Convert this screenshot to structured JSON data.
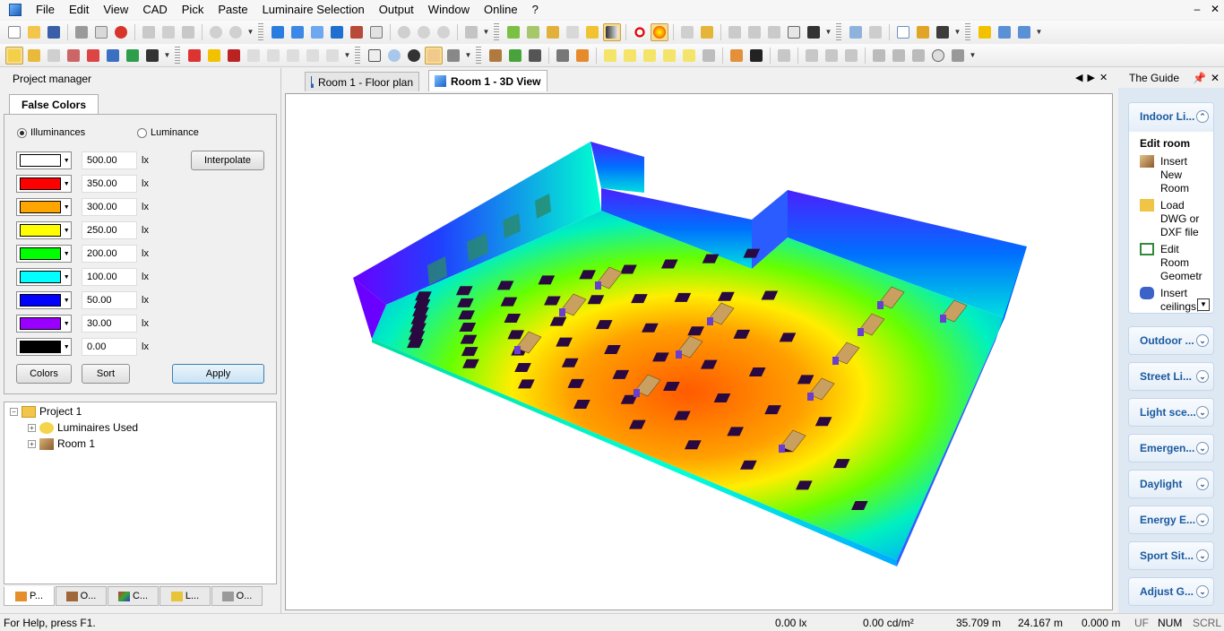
{
  "menu": [
    "File",
    "Edit",
    "View",
    "CAD",
    "Pick",
    "Paste",
    "Luminaire Selection",
    "Output",
    "Window",
    "Online",
    "?"
  ],
  "window_controls": [
    "–",
    "✕"
  ],
  "project_manager": {
    "title": "Project manager",
    "tab": "False Colors",
    "radio_illuminances": "Illuminances",
    "radio_luminance": "Luminance",
    "selected_radio": "Illuminances",
    "levels": [
      {
        "value": "500.00",
        "unit": "lx",
        "color": "#ffffff"
      },
      {
        "value": "350.00",
        "unit": "lx",
        "color": "#ff0000"
      },
      {
        "value": "300.00",
        "unit": "lx",
        "color": "#ffa500"
      },
      {
        "value": "250.00",
        "unit": "lx",
        "color": "#ffff00"
      },
      {
        "value": "200.00",
        "unit": "lx",
        "color": "#00ff00"
      },
      {
        "value": "100.00",
        "unit": "lx",
        "color": "#00ffff"
      },
      {
        "value": "50.00",
        "unit": "lx",
        "color": "#0000ff"
      },
      {
        "value": "30.00",
        "unit": "lx",
        "color": "#9900ff"
      },
      {
        "value": "0.00",
        "unit": "lx",
        "color": "#000000"
      }
    ],
    "interpolate_label": "Interpolate",
    "colors_label": "Colors",
    "sort_label": "Sort",
    "apply_label": "Apply"
  },
  "tree": {
    "project": "Project 1",
    "luminaires": "Luminaires Used",
    "room": "Room 1"
  },
  "bottom_tabs": [
    "P...",
    "O...",
    "C...",
    "L...",
    "O..."
  ],
  "doc_tabs": {
    "floor_plan": "Room 1 - Floor plan",
    "view_3d": "Room 1 - 3D View"
  },
  "guide": {
    "title": "The Guide",
    "expanded_section": "Indoor Li...",
    "subheading": "Edit room",
    "items": [
      {
        "label": "Insert\nNew\nRoom",
        "icon": "room-box-icon"
      },
      {
        "label": "Load\nDWG or\nDXF file",
        "icon": "dxf-folder-icon"
      },
      {
        "label": "Edit\nRoom\nGeometr",
        "icon": "geometry-edit-icon"
      },
      {
        "label": "Insert\nceilings,\nground",
        "icon": "ceiling-cylinder-icon"
      }
    ],
    "sections": [
      "Outdoor ...",
      "Street Li...",
      "Light sce...",
      "Emergen...",
      "Daylight",
      "Energy E...",
      "Sport Sit...",
      "Adjust G..."
    ]
  },
  "status": {
    "help": "For Help, press F1.",
    "illuminance": "0.00 lx",
    "luminance": "0.00 cd/m²",
    "x": "35.709 m",
    "y": "24.167 m",
    "z": "0.000 m",
    "uf": "UF",
    "num": "NUM",
    "scrl": "SCRL"
  }
}
